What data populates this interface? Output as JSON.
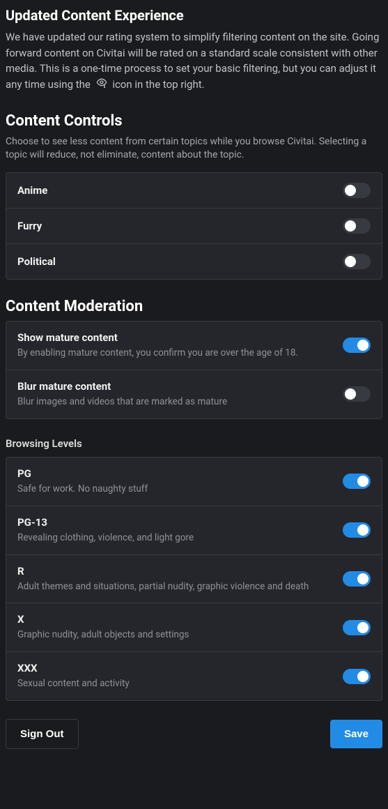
{
  "header": {
    "title": "Updated Content Experience",
    "intro_before": "We have updated our rating system to simplify filtering content on the site. Going forward content on Civitai will be rated on a standard scale consistent with other media. This is a one-time process to set your basic filtering, but you can adjust it any time using the ",
    "intro_after": " icon in the top right."
  },
  "content_controls": {
    "title": "Content Controls",
    "desc": "Choose to see less content from certain topics while you browse Civitai. Selecting a topic will reduce, not eliminate, content about the topic.",
    "items": [
      {
        "label": "Anime",
        "on": false
      },
      {
        "label": "Furry",
        "on": false
      },
      {
        "label": "Political",
        "on": false
      }
    ]
  },
  "content_moderation": {
    "title": "Content Moderation",
    "items": [
      {
        "label": "Show mature content",
        "sub": "By enabling mature content, you confirm you are over the age of 18.",
        "on": true
      },
      {
        "label": "Blur mature content",
        "sub": "Blur images and videos that are marked as mature",
        "on": false
      }
    ]
  },
  "browsing_levels": {
    "title": "Browsing Levels",
    "items": [
      {
        "label": "PG",
        "sub": "Safe for work. No naughty stuff",
        "on": true
      },
      {
        "label": "PG-13",
        "sub": "Revealing clothing, violence, and light gore",
        "on": true
      },
      {
        "label": "R",
        "sub": "Adult themes and situations, partial nudity, graphic violence and death",
        "on": true
      },
      {
        "label": "X",
        "sub": "Graphic nudity, adult objects and settings",
        "on": true
      },
      {
        "label": "XXX",
        "sub": "Sexual content and activity",
        "on": true
      }
    ]
  },
  "footer": {
    "sign_out": "Sign Out",
    "save": "Save"
  }
}
